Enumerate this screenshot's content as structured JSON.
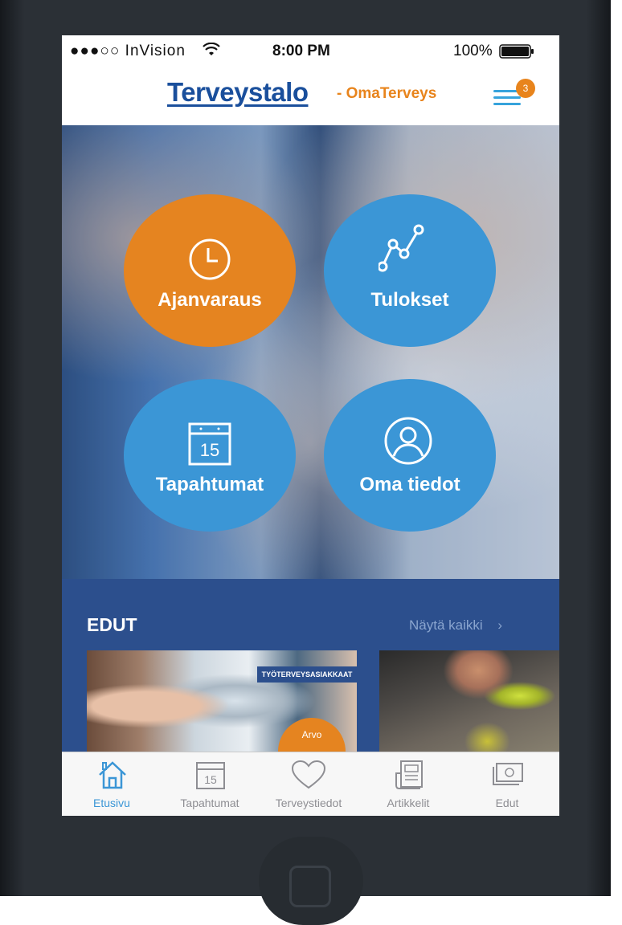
{
  "status_bar": {
    "carrier": "●●●○○ InVision",
    "time": "8:00 PM",
    "battery": "100%"
  },
  "header": {
    "logo": "Terveystalo",
    "subtitle": "- OmaTerveys",
    "menu_badge": "3"
  },
  "tiles": [
    {
      "label": "Ajanvaraus",
      "icon": "clock-icon",
      "color": "#e58420"
    },
    {
      "label": "Tulokset",
      "icon": "chart-line-icon",
      "color": "#3b96d6"
    },
    {
      "label": "Tapahtumat",
      "icon": "calendar-icon",
      "color": "#3b96d6",
      "icon_text": "15"
    },
    {
      "label": "Oma tiedot",
      "icon": "user-icon",
      "color": "#3b96d6"
    }
  ],
  "benefits": {
    "title": "EDUT",
    "see_all": "Näytä kaikki",
    "cards": [
      {
        "banner": "TYÖTERVEYSASIAKKAAT",
        "value_label": "Arvo"
      },
      {
        "banner": ""
      }
    ]
  },
  "tab_bar": {
    "items": [
      {
        "label": "Etusivu",
        "icon": "home-icon",
        "active": true
      },
      {
        "label": "Tapahtumat",
        "icon": "calendar-icon",
        "icon_text": "15",
        "active": false
      },
      {
        "label": "Terveystiedot",
        "icon": "heart-icon",
        "active": false
      },
      {
        "label": "Artikkelit",
        "icon": "article-icon",
        "active": false
      },
      {
        "label": "Edut",
        "icon": "money-icon",
        "active": false
      }
    ]
  },
  "colors": {
    "brand_blue": "#1a4f9c",
    "accent_orange": "#e58420",
    "tile_blue": "#3b96d6",
    "benefits_bg": "#2c4f8d"
  }
}
